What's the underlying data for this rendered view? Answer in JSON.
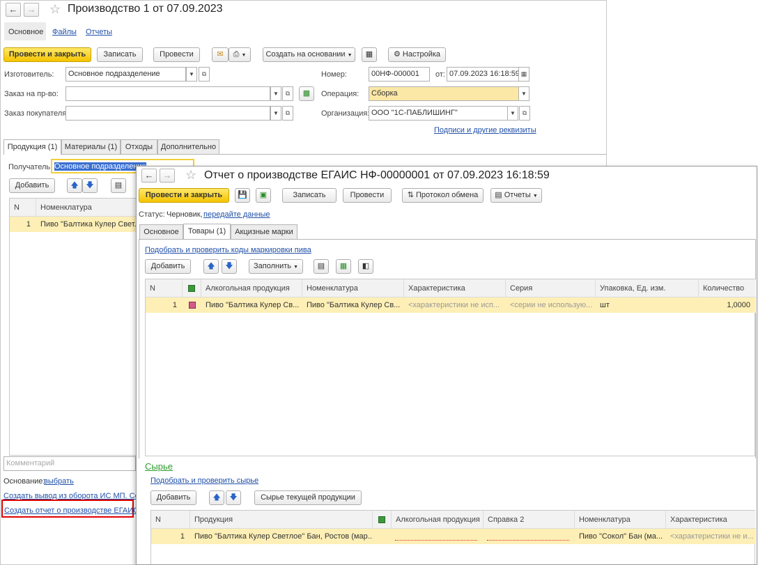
{
  "back_window": {
    "title": "Производство 1 от 07.09.2023",
    "tabs": [
      "Основное",
      "Файлы",
      "Отчеты"
    ],
    "toolbar": {
      "post_close": "Провести и закрыть",
      "save": "Записать",
      "post": "Провести",
      "create_based": "Создать на основании",
      "settings": "Настройка"
    },
    "fields": {
      "manufacturer_label": "Изготовитель:",
      "manufacturer_value": "Основное подразделение",
      "prod_order_label": "Заказ на пр-во:",
      "prod_order_value": "",
      "customer_order_label": "Заказ покупателя:",
      "customer_order_value": "",
      "number_label": "Номер:",
      "number_value": "00НФ-000001",
      "date_label": "от:",
      "date_value": "07.09.2023 16:18:59",
      "operation_label": "Операция:",
      "operation_value": "Сборка",
      "org_label": "Организация:",
      "org_value": "ООО \"1С-ПАБЛИШИНГ\""
    },
    "signatures_link": "Подписи и другие реквизиты",
    "sub_tabs": [
      "Продукция (1)",
      "Материалы (1)",
      "Отходы",
      "Дополнительно"
    ],
    "recipient_label": "Получатель:",
    "recipient_value": "Основное подразделение",
    "add_button": "Добавить",
    "grid": {
      "columns": [
        "N",
        "Номенклатура"
      ],
      "rows": [
        {
          "n": "1",
          "nomenclature": "Пиво \"Балтика Кулер Свет..."
        }
      ]
    },
    "comment_placeholder": "Комментарий",
    "basis_label": "Основание:",
    "basis_link": "выбрать",
    "create_withdrawal_link": "Создать вывод из оборота ИС МП. Созд",
    "create_report_link": "Создать отчет о производстве ЕГАИС"
  },
  "front_window": {
    "title": "Отчет о производстве ЕГАИС НФ-00000001 от 07.09.2023 16:18:59",
    "toolbar": {
      "post_close": "Провести и закрыть",
      "save": "Записать",
      "post": "Провести",
      "exchange_log": "Протокол обмена",
      "reports": "Отчеты"
    },
    "status_label": "Статус:",
    "status_value": "Черновик,",
    "status_link": "передайте данные",
    "tabs": [
      "Основное",
      "Товары (1)",
      "Акцизные марки"
    ],
    "pick_codes_link": "Подобрать и проверить коды маркировки пива",
    "add_button": "Добавить",
    "fill_button": "Заполнить",
    "goods_grid": {
      "columns": [
        "N",
        "",
        "Алкогольная продукция",
        "Номенклатура",
        "Характеристика",
        "Серия",
        "Упаковка, Ед. изм.",
        "Количество"
      ],
      "rows": [
        {
          "n": "1",
          "alcohol": "Пиво \"Балтика Кулер Св...",
          "nomenclature": "Пиво \"Балтика Кулер Св...",
          "characteristic": "<характеристики не исп...",
          "series": "<серии не использую...",
          "unit": "шт",
          "quantity": "1,0000"
        }
      ]
    },
    "raw_section_title": "Сырье",
    "pick_raw_link": "Подобрать и проверить сырье",
    "raw_add_button": "Добавить",
    "raw_current_button": "Сырье текущей продукции",
    "raw_grid": {
      "columns": [
        "N",
        "Продукция",
        "",
        "Алкогольная продукция",
        "Справка 2",
        "Номенклатура",
        "Характеристика"
      ],
      "rows": [
        {
          "n": "1",
          "product": "Пиво \"Балтика Кулер Светлое\" Бан, Ростов (мар...",
          "alcohol": "",
          "certificate": "",
          "nomenclature": "Пиво \"Сокол\" Бан (ма...",
          "characteristic": "<характеристики не и..."
        }
      ]
    }
  },
  "colors": {
    "primary_yellow": "#f5c400",
    "row_highlight": "#fdefb6",
    "link_blue": "#1f4fa8",
    "section_green": "#2a9d2a",
    "callout_red": "#e00000"
  }
}
